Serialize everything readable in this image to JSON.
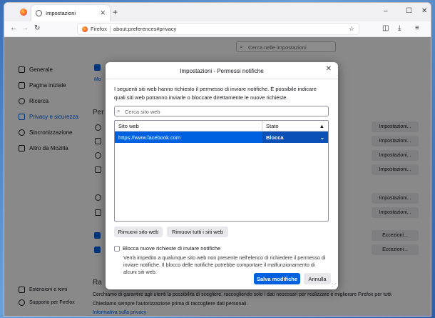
{
  "browser": {
    "tab_title": "Impostazioni",
    "new_tab": "+",
    "controls": {
      "minimize": "–",
      "maximize": "☐",
      "close": "✕"
    },
    "nav": {
      "back": "←",
      "forward": "→",
      "reload": "↻"
    },
    "url_brand": "Firefox",
    "url": "about:preferences#privacy",
    "bookmark_star": "☆",
    "right_icons": {
      "pocket": "◫",
      "download": "⤓",
      "menu": "≡"
    }
  },
  "prefs": {
    "search_placeholder": "Cerca nelle impostazioni",
    "sidebar": [
      {
        "label": "Generale"
      },
      {
        "label": "Pagina iniziale"
      },
      {
        "label": "Ricerca"
      },
      {
        "label": "Privacy e sicurezza"
      },
      {
        "label": "Sincronizzazione"
      },
      {
        "label": "Altro da Mozilla"
      }
    ],
    "sidebar_footer": [
      {
        "label": "Estensioni e temi"
      },
      {
        "label": "Supporto per Firefox"
      }
    ],
    "permission_buttons": [
      "Impostazioni...",
      "Impostazioni...",
      "Impostazioni...",
      "Impostazioni...",
      "Impostazioni...",
      "Impostazioni..."
    ],
    "exception_buttons": [
      "Eccezioni...",
      "Eccezioni..."
    ],
    "section_partial": "Per",
    "mo_partial": "Mo",
    "bottom_heading_partial": "Ra",
    "bottom_text_1": "Cerchiamo di garantire agli utenti la possibilità di scegliere, raccogliendo solo i dati necessari per realizzare e migliorare Firefox per tutti.",
    "bottom_text_2": "Chiediamo sempre l'autorizzazione prima di raccogliere dati personali.",
    "bottom_link": "Informativa sulla privacy"
  },
  "dialog": {
    "title": "Impostazioni - Permessi notifiche",
    "close": "✕",
    "description": "I seguenti siti web hanno richiesto il permesso di inviare notifiche. È possibile indicare quali siti web potranno inviarle o bloccare direttamente le nuove richieste.",
    "search_placeholder": "Cerca sito web",
    "col_site": "Sito web",
    "col_state": "Stato",
    "sort_arrow": "▲",
    "rows": [
      {
        "site": "https://www.facebook.com",
        "state": "Blocca",
        "chevron": "⌄"
      }
    ],
    "remove_site": "Rimuovi sito web",
    "remove_all": "Rimuovi tutti i siti web",
    "block_new_label": "Blocca nuove richieste di inviare notifiche",
    "block_new_checked": false,
    "block_new_note": "Verrà impedito a qualunque sito web non presente nell'elenco di richiedere il permesso di inviare notifiche. Il blocco delle notifiche potrebbe comportare il malfunzionamento di alcuni siti web.",
    "save": "Salva modifiche",
    "cancel": "Annulla"
  },
  "colors": {
    "accent": "#0061e0",
    "selected_row": "#0061e0"
  }
}
